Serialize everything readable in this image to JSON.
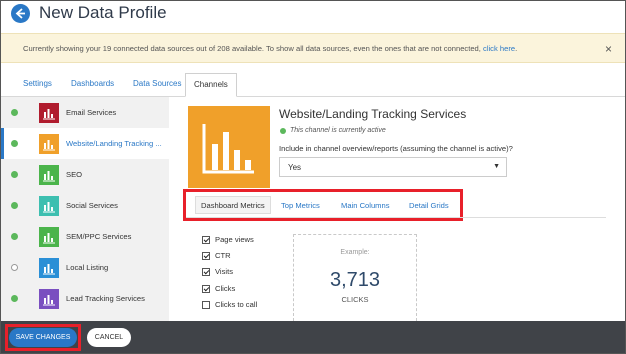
{
  "header": {
    "title": "New Data Profile"
  },
  "notice": {
    "text": "Currently showing your 19 connected data sources out of 208 available. To show all data sources, even the ones that are not connected,",
    "link": "click here",
    "close": "×"
  },
  "top_tabs": [
    {
      "label": "Settings"
    },
    {
      "label": "Dashboards"
    },
    {
      "label": "Data Sources"
    },
    {
      "label": "Channels",
      "active": true
    }
  ],
  "sidebar": {
    "items": [
      {
        "label": "Email Services",
        "status": "active",
        "color": "#b01c2e"
      },
      {
        "label": "Website/Landing Tracking ...",
        "status": "active",
        "color": "#f0a02a",
        "selected": true
      },
      {
        "label": "SEO",
        "status": "active",
        "color": "#4bb44b"
      },
      {
        "label": "Social Services",
        "status": "active",
        "color": "#3dbfb0"
      },
      {
        "label": "SEM/PPC Services",
        "status": "active",
        "color": "#4bb44b"
      },
      {
        "label": "Local Listing",
        "status": "inactive",
        "color": "#2a8fd6"
      },
      {
        "label": "Lead Tracking Services",
        "status": "active",
        "color": "#7a4fc0"
      }
    ]
  },
  "channel": {
    "title": "Website/Landing Tracking Services",
    "status": "This channel is currently active",
    "question": "Include in channel overview/reports (assuming the channel is active)?",
    "select_value": "Yes",
    "tile_color": "#f0a02a"
  },
  "sub_tabs": [
    {
      "label": "Dashboard Metrics",
      "active": true
    },
    {
      "label": "Top Metrics"
    },
    {
      "label": "Main Columns"
    },
    {
      "label": "Detail Grids"
    }
  ],
  "metrics": [
    {
      "label": "Page views",
      "checked": true
    },
    {
      "label": "CTR",
      "checked": true
    },
    {
      "label": "Visits",
      "checked": true
    },
    {
      "label": "Clicks",
      "checked": true
    },
    {
      "label": "Clicks to call",
      "checked": false
    }
  ],
  "example": {
    "label": "Example:",
    "value": "3,713",
    "unit": "CLICKS"
  },
  "footer": {
    "save_label": "SAVE CHANGES",
    "cancel_label": "CANCEL"
  }
}
